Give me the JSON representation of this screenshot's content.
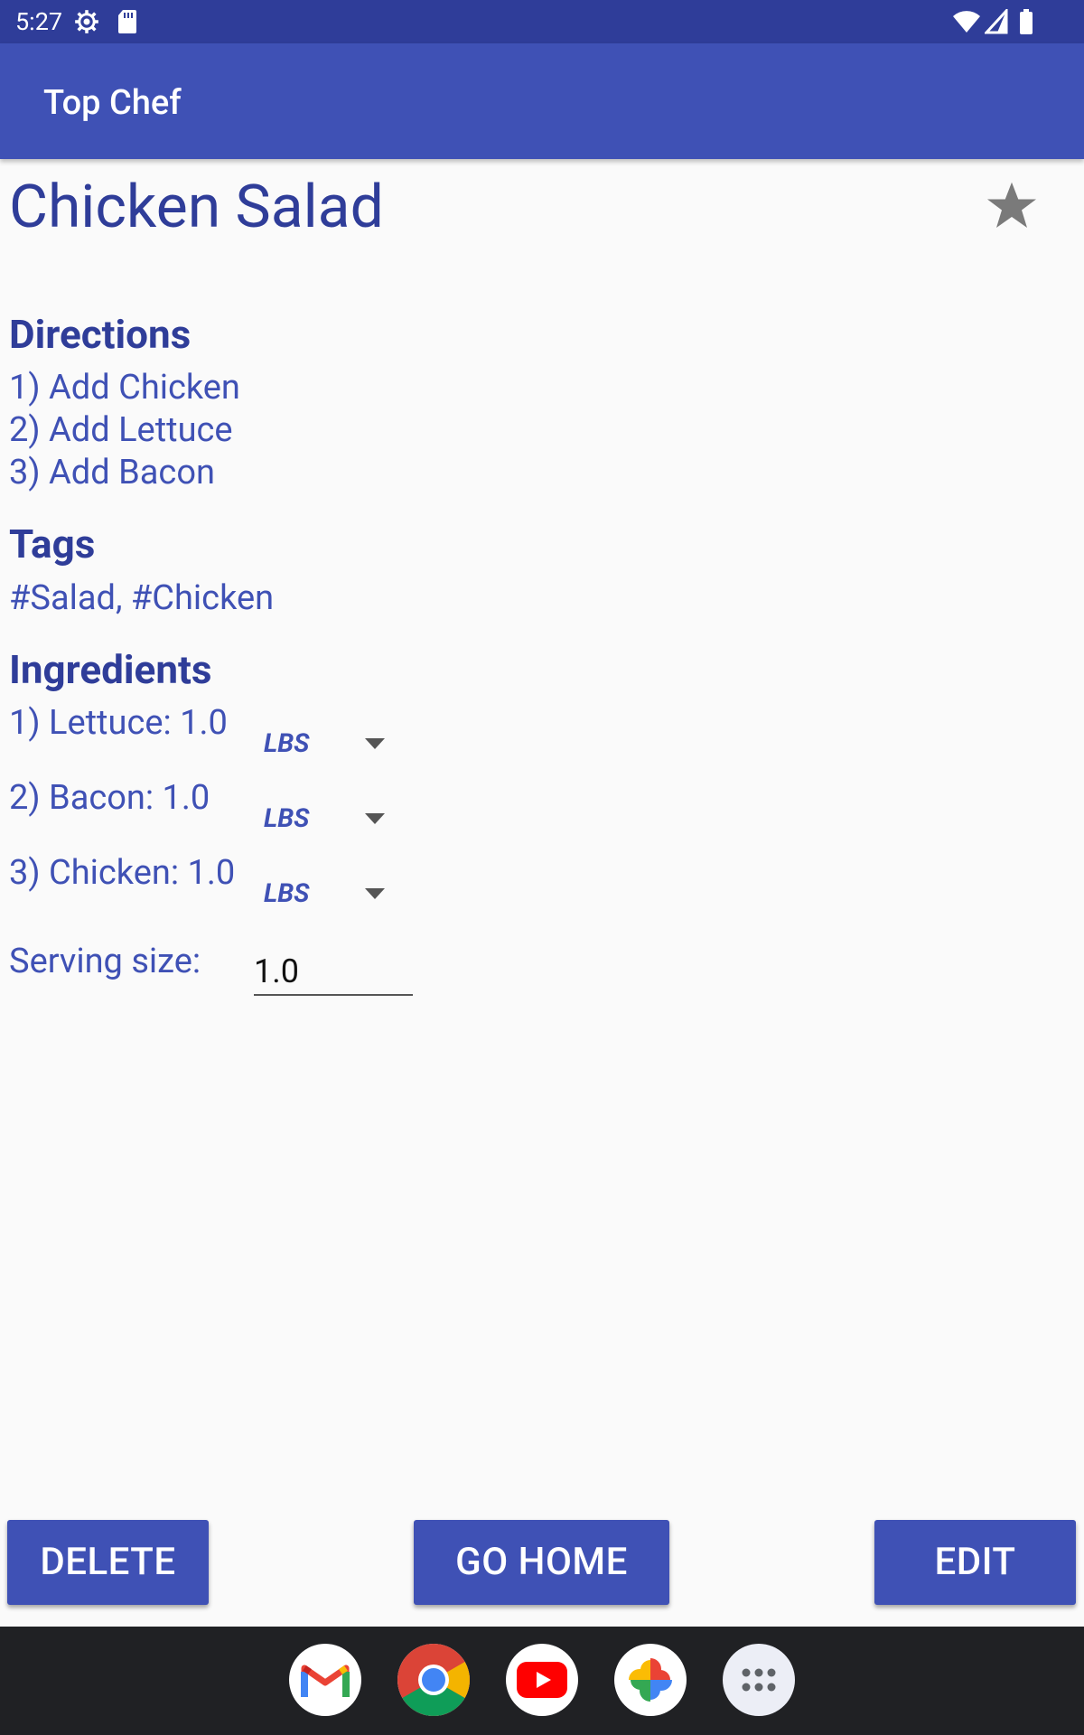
{
  "status_bar": {
    "time": "5:27"
  },
  "app_bar": {
    "title": "Top Chef"
  },
  "recipe": {
    "title": "Chicken Salad",
    "favorite_icon": "star-icon",
    "directions_heading": "Directions",
    "directions": [
      "1) Add Chicken",
      "2) Add Lettuce",
      "3) Add Bacon"
    ],
    "tags_heading": "Tags",
    "tags": "#Salad, #Chicken",
    "ingredients_heading": "Ingredients",
    "ingredients": [
      {
        "text": "1) Lettuce: 1.0",
        "unit": "LBS"
      },
      {
        "text": "2) Bacon: 1.0",
        "unit": "LBS"
      },
      {
        "text": "3) Chicken: 1.0",
        "unit": "LBS"
      }
    ],
    "serving_label": "Serving size:",
    "serving_value": "1.0"
  },
  "buttons": {
    "delete": "DELETE",
    "go_home": "GO HOME",
    "edit": "EDIT"
  },
  "dock": [
    "gmail-icon",
    "chrome-icon",
    "youtube-icon",
    "photos-icon",
    "app-drawer-icon"
  ],
  "colors": {
    "primary": "#3f51b5",
    "primary_dark": "#2f3d99",
    "background": "#fafafa"
  }
}
